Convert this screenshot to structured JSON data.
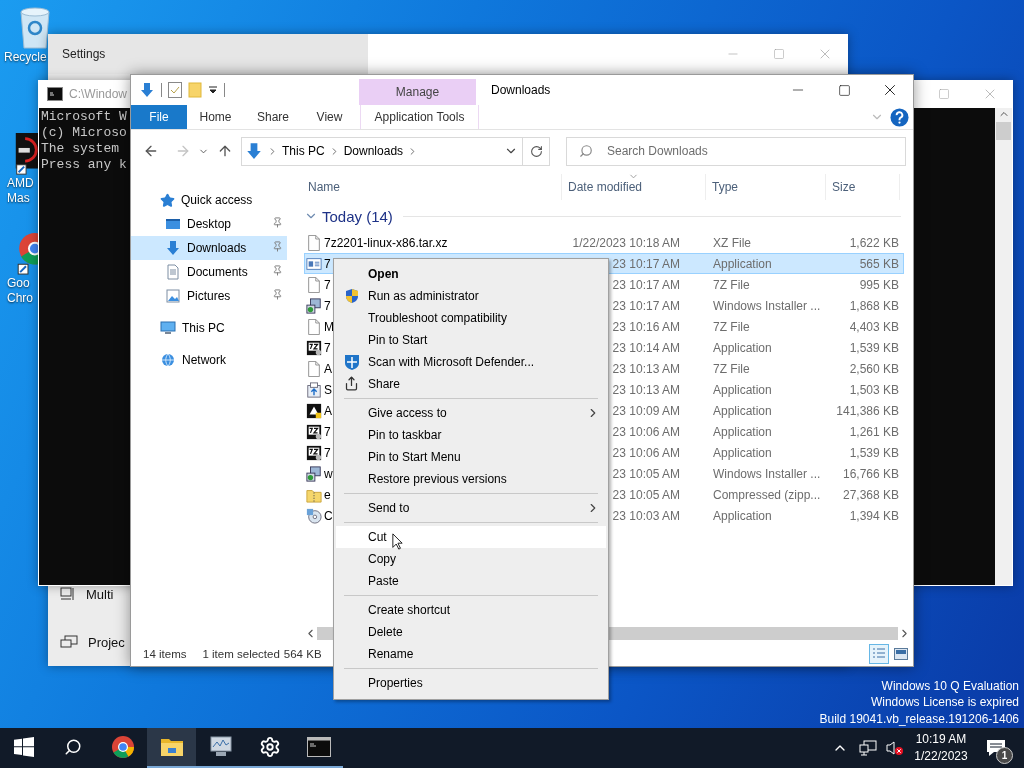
{
  "desktop": {
    "icons": [
      {
        "kind": "recycle-bin",
        "label": "Recycle"
      },
      {
        "kind": "amd",
        "label": "AMD",
        "label_2": "Mas"
      },
      {
        "kind": "chrome",
        "label": "Goo",
        "label_2": "Chro"
      }
    ],
    "notice": [
      "Windows 10 Q Evaluation",
      "Windows License is expired",
      "Build 19041.vb_release.191206-1406"
    ]
  },
  "settings_window": {
    "title": "Settings",
    "nav_items": [
      {
        "kind": "multitasking",
        "label": "Multi"
      },
      {
        "kind": "projecting",
        "label": "Projec"
      }
    ]
  },
  "console_window": {
    "title": "C:\\Window",
    "lines": [
      "Microsoft W",
      "(c) Microso",
      "The system",
      "Press any k"
    ]
  },
  "explorer": {
    "title": "Downloads",
    "context_group": "Manage",
    "tabs": [
      {
        "kind": "file",
        "label": "File"
      },
      {
        "kind": "tab",
        "label": "Home"
      },
      {
        "kind": "tab",
        "label": "Share"
      },
      {
        "kind": "tab",
        "label": "View"
      },
      {
        "kind": "contextual",
        "label": "Application Tools"
      }
    ],
    "path": [
      "This PC",
      "Downloads"
    ],
    "search": {
      "placeholder": "Search Downloads"
    },
    "nav": [
      {
        "kind": "quick-access",
        "label": "Quick access",
        "selected": false,
        "pinned": false,
        "children": [
          {
            "kind": "desktop",
            "label": "Desktop",
            "selected": false,
            "pinned": true
          },
          {
            "kind": "downloads",
            "label": "Downloads",
            "selected": true,
            "pinned": true
          },
          {
            "kind": "documents",
            "label": "Documents",
            "selected": false,
            "pinned": true
          },
          {
            "kind": "pictures",
            "label": "Pictures",
            "selected": false,
            "pinned": true
          }
        ]
      },
      {
        "kind": "pc",
        "label": "This PC",
        "selected": false,
        "pinned": false
      },
      {
        "kind": "network",
        "label": "Network",
        "selected": false,
        "pinned": false
      }
    ],
    "columns": [
      {
        "label": "Name",
        "sorted": false
      },
      {
        "label": "Date modified",
        "sorted": true
      },
      {
        "label": "Type",
        "sorted": false
      },
      {
        "label": "Size",
        "sorted": false
      }
    ],
    "group": {
      "label": "Today (14)",
      "expanded": true
    },
    "rows": [
      {
        "kind": "document",
        "name": "7z2201-linux-x86.tar.xz",
        "date": "1/22/2023 10:18 AM",
        "type": "XZ File",
        "size": "1,622 KB",
        "selected": false
      },
      {
        "kind": "window",
        "name": "7",
        "date": "23 10:17 AM",
        "type": "Application",
        "size": "565 KB",
        "selected": true
      },
      {
        "kind": "document",
        "name": "7",
        "date": "23 10:17 AM",
        "type": "7Z File",
        "size": "995 KB",
        "selected": false
      },
      {
        "kind": "installer",
        "name": "7",
        "date": "23 10:17 AM",
        "type": "Windows Installer ...",
        "size": "1,868 KB",
        "selected": false
      },
      {
        "kind": "document",
        "name": "M",
        "date": "23 10:16 AM",
        "type": "7Z File",
        "size": "4,403 KB",
        "selected": false
      },
      {
        "kind": "archive",
        "name": "7",
        "date": "23 10:14 AM",
        "type": "Application",
        "size": "1,539 KB",
        "selected": false
      },
      {
        "kind": "document",
        "name": "A",
        "date": "23 10:13 AM",
        "type": "7Z File",
        "size": "2,560 KB",
        "selected": false
      },
      {
        "kind": "setup",
        "name": "S",
        "date": "23 10:13 AM",
        "type": "Application",
        "size": "1,503 KB",
        "selected": false
      },
      {
        "kind": "dark-app",
        "name": "A",
        "date": "23 10:09 AM",
        "type": "Application",
        "size": "141,386 KB",
        "selected": false
      },
      {
        "kind": "archive",
        "name": "7",
        "date": "23 10:06 AM",
        "type": "Application",
        "size": "1,261 KB",
        "selected": false
      },
      {
        "kind": "archive",
        "name": "7",
        "date": "23 10:06 AM",
        "type": "Application",
        "size": "1,539 KB",
        "selected": false
      },
      {
        "kind": "installer",
        "name": "w",
        "date": "23 10:05 AM",
        "type": "Windows Installer ...",
        "size": "16,766 KB",
        "selected": false
      },
      {
        "kind": "zip",
        "name": "e",
        "date": "23 10:05 AM",
        "type": "Compressed (zipp...",
        "size": "27,368 KB",
        "selected": false
      },
      {
        "kind": "disc",
        "name": "C",
        "date": "23 10:03 AM",
        "type": "Application",
        "size": "1,394 KB",
        "selected": false
      }
    ],
    "status": {
      "count": "14 items",
      "selection": "1 item selected",
      "size": "564 KB"
    },
    "views": [
      {
        "kind": "details",
        "selected": true
      },
      {
        "kind": "large-icons",
        "selected": false
      }
    ]
  },
  "context_menu": {
    "groups": [
      [
        {
          "kind": "default",
          "label": "Open",
          "highlighted": false
        },
        {
          "kind": "admin",
          "label": "Run as administrator",
          "highlighted": false
        },
        {
          "kind": "plain",
          "label": "Troubleshoot compatibility",
          "highlighted": false
        },
        {
          "kind": "plain",
          "label": "Pin to Start",
          "highlighted": false
        },
        {
          "kind": "scan",
          "label": "Scan with Microsoft Defender...",
          "highlighted": false
        },
        {
          "kind": "share",
          "label": "Share",
          "highlighted": false
        }
      ],
      [
        {
          "kind": "submenu",
          "label": "Give access to",
          "highlighted": false
        },
        {
          "kind": "plain",
          "label": "Pin to taskbar",
          "highlighted": false
        },
        {
          "kind": "plain",
          "label": "Pin to Start Menu",
          "highlighted": false
        },
        {
          "kind": "plain",
          "label": "Restore previous versions",
          "highlighted": false
        }
      ],
      [
        {
          "kind": "submenu",
          "label": "Send to",
          "highlighted": false
        }
      ],
      [
        {
          "kind": "plain",
          "label": "Cut",
          "highlighted": true
        },
        {
          "kind": "plain",
          "label": "Copy",
          "highlighted": false
        },
        {
          "kind": "plain",
          "label": "Paste",
          "highlighted": false
        }
      ],
      [
        {
          "kind": "plain",
          "label": "Create shortcut",
          "highlighted": false
        },
        {
          "kind": "plain",
          "label": "Delete",
          "highlighted": false
        },
        {
          "kind": "plain",
          "label": "Rename",
          "highlighted": false
        }
      ],
      [
        {
          "kind": "plain",
          "label": "Properties",
          "highlighted": false
        }
      ]
    ]
  },
  "taskbar": {
    "apps": [
      {
        "kind": "chrome",
        "running": false,
        "active": false
      },
      {
        "kind": "explorer",
        "running": true,
        "active": true
      },
      {
        "kind": "task-manager",
        "running": true,
        "active": false
      },
      {
        "kind": "settings",
        "running": true,
        "active": false
      },
      {
        "kind": "console",
        "running": true,
        "active": false
      }
    ],
    "time": "10:19 AM",
    "date": "1/22/2023",
    "notification_count": "1"
  }
}
